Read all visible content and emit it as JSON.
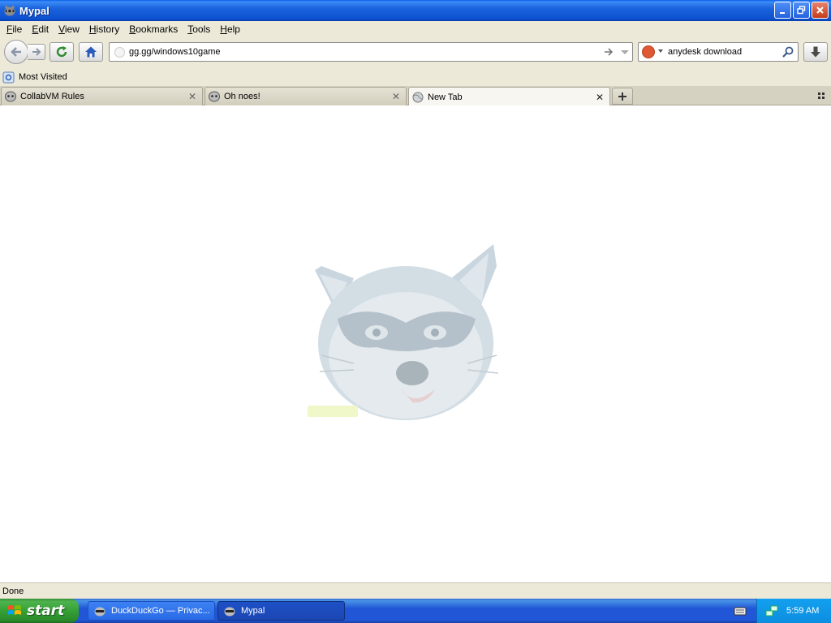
{
  "window": {
    "title": "Mypal"
  },
  "menu": [
    {
      "label": "File",
      "accel": "F",
      "rest": "ile"
    },
    {
      "label": "Edit",
      "accel": "E",
      "rest": "dit"
    },
    {
      "label": "View",
      "accel": "V",
      "rest": "iew"
    },
    {
      "label": "History",
      "accel": "H",
      "rest": "istory"
    },
    {
      "label": "Bookmarks",
      "accel": "B",
      "rest": "ookmarks"
    },
    {
      "label": "Tools",
      "accel": "T",
      "rest": "ools"
    },
    {
      "label": "Help",
      "accel": "H",
      "rest": "elp"
    }
  ],
  "nav": {
    "url": "gg.gg/windows10game",
    "search_value": "anydesk download"
  },
  "bookmarks": [
    {
      "label": "Most Visited"
    }
  ],
  "tabs": [
    {
      "label": "CollabVM Rules",
      "active": false
    },
    {
      "label": "Oh noes!",
      "active": false
    },
    {
      "label": "New Tab",
      "active": true
    }
  ],
  "status": {
    "text": "Done"
  },
  "taskbar": {
    "start_label": "start",
    "tasks": [
      {
        "label": "DuckDuckGo — Privac...",
        "active": false
      },
      {
        "label": "Mypal",
        "active": true
      }
    ],
    "clock": "5:59 AM"
  },
  "colors": {
    "titlebar": "#0d52d1",
    "taskbar": "#2157d7",
    "start_button": "#35a135",
    "tray": "#0d8ee0",
    "chrome": "#ece9d8"
  },
  "icons": {
    "app": "raccoon-icon",
    "back": "back-arrow-icon",
    "forward": "forward-arrow-icon",
    "reload": "reload-icon",
    "home": "home-icon",
    "search": "magnifier-icon",
    "download": "download-arrow-icon"
  }
}
